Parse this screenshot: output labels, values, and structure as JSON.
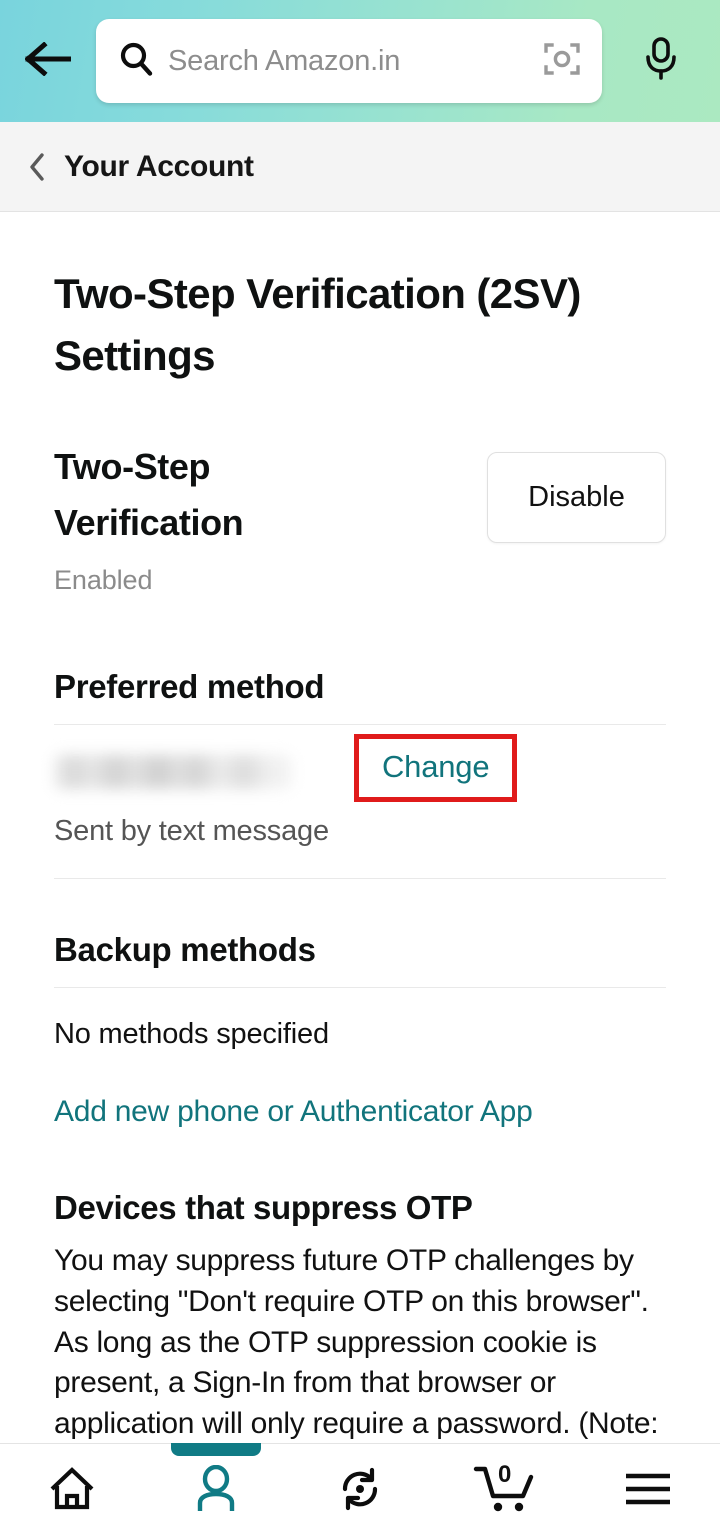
{
  "header": {
    "back_icon": "arrow-left-icon",
    "search": {
      "icon": "search-icon",
      "placeholder": "Search Amazon.in",
      "value": "",
      "camera_icon": "camera-lens-icon"
    },
    "mic_icon": "microphone-icon",
    "gradient_from": "#79d4dd",
    "gradient_to": "#abe9c1"
  },
  "subheader": {
    "back_chevron_icon": "chevron-left-icon",
    "title": "Your Account",
    "background": "#f4f4f4"
  },
  "page": {
    "title": "Two-Step Verification (2SV) Settings"
  },
  "verification": {
    "heading": "Two-Step Verification",
    "status": "Enabled",
    "action_label": "Disable"
  },
  "preferred_method": {
    "heading": "Preferred method",
    "value_redacted": "",
    "sub_label": "Sent by text message",
    "change_label": "Change",
    "highlight_color": "#e01b1b"
  },
  "backup_methods": {
    "heading": "Backup methods",
    "empty_text": "No methods specified",
    "add_link_label": "Add new phone or Authenticator App"
  },
  "otp_section": {
    "heading": "Devices that suppress OTP",
    "body": "You may suppress future OTP challenges by selecting \"Don't require OTP on this browser\". As long as the OTP suppression cookie is present, a Sign-In from that browser or application will only require a password. (Note: This option is enabled separately for each browser that you use.)"
  },
  "bottom_nav": {
    "accent_color": "#107b85",
    "active_index": 1,
    "items": [
      {
        "icon": "home-icon",
        "label": "",
        "active": false
      },
      {
        "icon": "person-icon",
        "label": "",
        "active": true
      },
      {
        "icon": "refresh-sync-icon",
        "label": "",
        "active": false
      },
      {
        "icon": "shopping-cart-icon",
        "label": "",
        "active": false,
        "badge": "0"
      },
      {
        "icon": "hamburger-menu-icon",
        "label": "",
        "active": false
      }
    ]
  },
  "link_color": "#11747c"
}
